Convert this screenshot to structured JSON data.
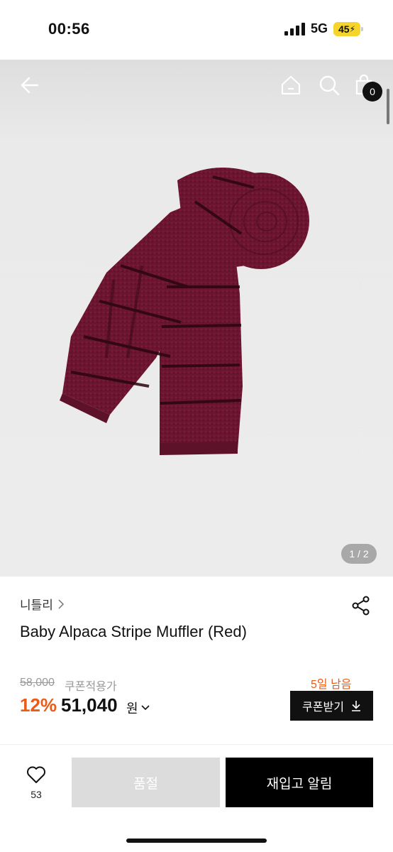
{
  "status_bar": {
    "time": "00:56",
    "network": "5G",
    "battery": "45"
  },
  "header": {
    "icons": [
      "back-arrow-icon",
      "home-icon",
      "search-icon",
      "shopping-bag-icon"
    ],
    "cart_count": "0"
  },
  "gallery": {
    "counter": "1 / 2",
    "product_color": "#6d1630"
  },
  "product": {
    "brand": "니틀리",
    "name": "Baby Alpaca Stripe Muffler (Red)",
    "original_price": "58,000",
    "price_note": "쿠폰적용가",
    "discount": "12%",
    "price": "51,040",
    "currency": "원",
    "days_left": "5일 남음",
    "coupon_label": "쿠폰받기"
  },
  "bottom_bar": {
    "like_count": "53",
    "soldout_label": "품절",
    "restock_label": "재입고 알림"
  },
  "colors": {
    "accent": "#ea5b18",
    "dark": "#111111",
    "disabled": "#dcdcdc"
  }
}
